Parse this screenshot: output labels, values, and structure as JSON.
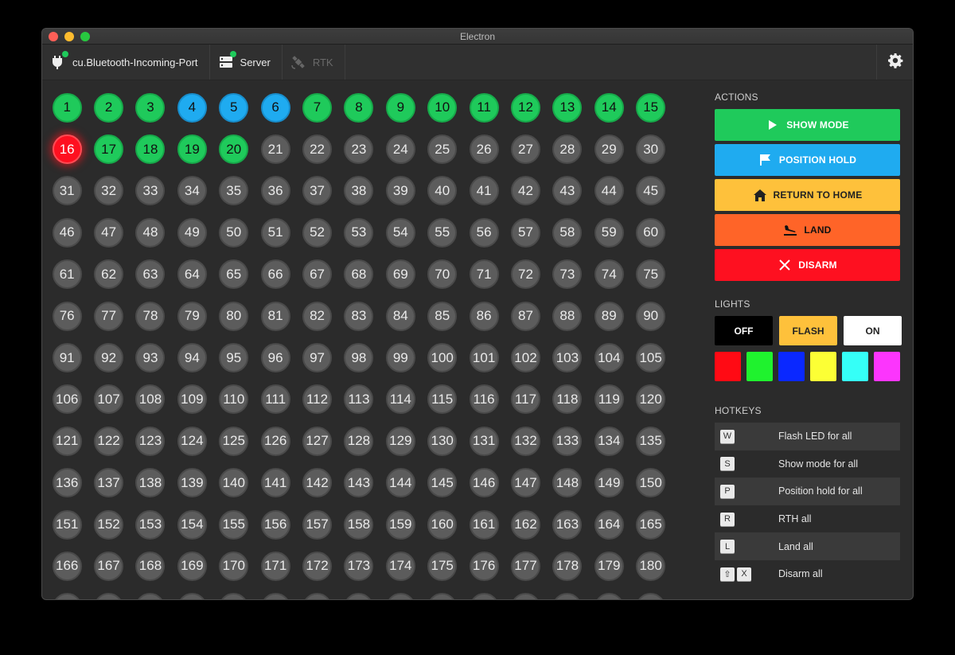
{
  "window": {
    "title": "Electron"
  },
  "toolbar": {
    "port_label": "cu.Bluetooth-Incoming-Port",
    "server_label": "Server",
    "rtk_label": "RTK"
  },
  "uavs": {
    "green": [
      1,
      2,
      3,
      7,
      8,
      9,
      10,
      11,
      12,
      13,
      14,
      15,
      17,
      18,
      19,
      20
    ],
    "blue": [
      4,
      5,
      6
    ],
    "red": [
      16
    ],
    "count": 195
  },
  "actions": {
    "heading": "ACTIONS",
    "show_mode": "SHOW MODE",
    "position_hold": "POSITION HOLD",
    "return_home": "RETURN TO HOME",
    "land": "LAND",
    "disarm": "DISARM"
  },
  "lights": {
    "heading": "LIGHTS",
    "off": "OFF",
    "flash": "FLASH",
    "on": "ON",
    "colors": [
      "#ff0a14",
      "#1ff22e",
      "#0a28ff",
      "#fcff35",
      "#35fff7",
      "#fc35fd"
    ]
  },
  "hotkeys": {
    "heading": "HOTKEYS",
    "items": [
      {
        "keys": [
          "W"
        ],
        "label": "Flash LED for all"
      },
      {
        "keys": [
          "S"
        ],
        "label": "Show mode for all"
      },
      {
        "keys": [
          "P"
        ],
        "label": "Position hold for all"
      },
      {
        "keys": [
          "R"
        ],
        "label": "RTH all"
      },
      {
        "keys": [
          "L"
        ],
        "label": "Land all"
      },
      {
        "keys": [
          "⇧",
          "X"
        ],
        "label": "Disarm all"
      }
    ]
  }
}
